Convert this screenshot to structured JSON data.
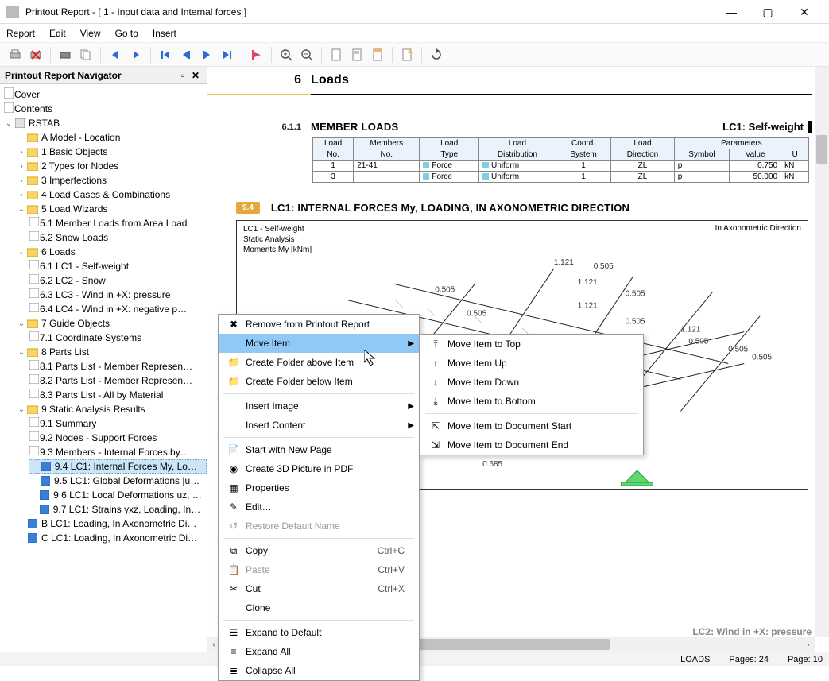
{
  "window": {
    "title": "Printout Report - [ 1 - Input data and Internal forces ]"
  },
  "menu": {
    "report": "Report",
    "edit": "Edit",
    "view": "View",
    "goto": "Go to",
    "insert": "Insert"
  },
  "nav": {
    "title": "Printout Report Navigator",
    "items": {
      "cover": "Cover",
      "contents": "Contents",
      "rstab": "RSTAB",
      "a": "A Model - Location",
      "n1": "1 Basic Objects",
      "n2": "2 Types for Nodes",
      "n3": "3 Imperfections",
      "n4": "4 Load Cases & Combinations",
      "n5": "5 Load Wizards",
      "n51": "5.1 Member Loads from Area Load",
      "n52": "5.2 Snow Loads",
      "n6": "6 Loads",
      "n61": "6.1 LC1 - Self-weight",
      "n62": "6.2 LC2 - Snow",
      "n63": "6.3 LC3 - Wind in +X: pressure",
      "n64": "6.4 LC4 - Wind in +X: negative p…",
      "n7": "7 Guide Objects",
      "n71": "7.1 Coordinate Systems",
      "n8": "8 Parts List",
      "n81": "8.1 Parts List - Member Represen…",
      "n82": "8.2 Parts List - Member Represen…",
      "n83": "8.3 Parts List - All by Material",
      "n9": "9 Static Analysis Results",
      "n91": "9.1 Summary",
      "n92": "9.2 Nodes - Support Forces",
      "n93": "9.3 Members - Internal Forces by…",
      "n94": "9.4 LC1: Internal Forces My, Loa…",
      "n95": "9.5 LC1: Global Deformations |u|…",
      "n96": "9.6 LC1: Local Deformations uz, L…",
      "n97": "9.7 LC1: Strains γxz, Loading, In A…",
      "b": "B LC1: Loading, In Axonometric Direc…",
      "c": "C LC1: Loading, In Axonometric Direc…"
    }
  },
  "doc": {
    "sec6num": "6",
    "sec6title": "Loads",
    "ml_sub": "6.1.1",
    "ml_title": "MEMBER LOADS",
    "ml_right": "LC1: Self-weight",
    "table": {
      "h_loadno1": "Load",
      "h_loadno2": "No.",
      "h_members1": "Members",
      "h_members2": "No.",
      "h_loadtype1": "Load",
      "h_loadtype2": "Type",
      "h_loaddist1": "Load",
      "h_loaddist2": "Distribution",
      "h_coord1": "Coord.",
      "h_coord2": "System",
      "h_dir1": "Load",
      "h_dir2": "Direction",
      "h_sym": "Symbol",
      "h_val": "Value",
      "h_params": "Parameters",
      "h_unit": "U",
      "rows": [
        {
          "no": "1",
          "members": "21-41",
          "type": "Force",
          "dist": "Uniform",
          "coord": "1",
          "dir": "ZL",
          "sym": "p",
          "val": "0.750",
          "unit": "kN"
        },
        {
          "no": "3",
          "members": "",
          "type": "Force",
          "dist": "Uniform",
          "coord": "1",
          "dir": "ZL",
          "sym": "p",
          "val": "50.000",
          "unit": "kN"
        }
      ]
    },
    "badge94": "9.4",
    "sec94title": "LC1: INTERNAL FORCES My, LOADING, IN AXONOMETRIC DIRECTION",
    "diag_tl1": "LC1 - Self-weight",
    "diag_tl2": "Static Analysis",
    "diag_tl3": "Moments My [kNm]",
    "diag_tr": "In Axonometric Direction",
    "diag_values": [
      "1.121",
      "0.505",
      "0.505",
      "1.121",
      "1.121",
      "0.505",
      "0.505",
      "0.505",
      "1.121",
      "0.505",
      "0.505",
      "0.505",
      "0.505",
      "0.505",
      "0.685"
    ],
    "lc2": "LC2: Wind in +X: pressure"
  },
  "ctx": {
    "remove": "Remove from Printout Report",
    "move": "Move Item",
    "cfabove": "Create Folder above Item",
    "cfbelow": "Create Folder below Item",
    "iimg": "Insert Image",
    "icont": "Insert Content",
    "snp": "Start with New Page",
    "c3d": "Create 3D Picture in PDF",
    "props": "Properties",
    "edit": "Edit…",
    "rdn": "Restore Default Name",
    "copy": "Copy",
    "copy_sc": "Ctrl+C",
    "paste": "Paste",
    "paste_sc": "Ctrl+V",
    "cut": "Cut",
    "cut_sc": "Ctrl+X",
    "clone": "Clone",
    "expdef": "Expand to Default",
    "expall": "Expand All",
    "colall": "Collapse All"
  },
  "sub": {
    "top": "Move Item to Top",
    "up": "Move Item Up",
    "down": "Move Item Down",
    "bottom": "Move Item to Bottom",
    "docstart": "Move Item to Document Start",
    "docend": "Move Item to Document End"
  },
  "status": {
    "loads": "LOADS",
    "pages": "Pages: 24",
    "page": "Page: 10"
  }
}
